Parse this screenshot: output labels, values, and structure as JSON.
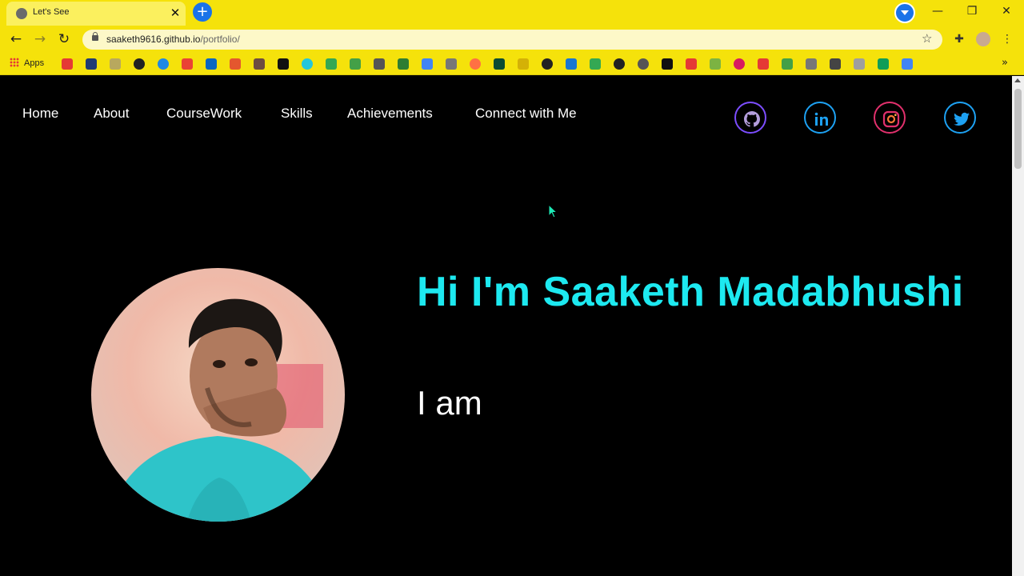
{
  "browser": {
    "tab_title": "Let's See",
    "url_host": "saaketh9616.github.io",
    "url_path": "/portfolio/",
    "bookmarks_apps_label": "Apps"
  },
  "nav": {
    "items": [
      "Home",
      "About",
      "CourseWork",
      "Skills",
      "Achievements",
      "Connect with Me"
    ]
  },
  "social": {
    "icons": [
      "github-icon",
      "linkedin-icon",
      "instagram-icon",
      "twitter-icon"
    ]
  },
  "hero": {
    "title": "Hi I'm Saaketh Madabhushi",
    "subtitle": "I am"
  },
  "colors": {
    "chrome": "#f5e20b",
    "title_accent": "#1de9f0",
    "page_bg": "#000000",
    "social_ring": "#1da1f2"
  }
}
